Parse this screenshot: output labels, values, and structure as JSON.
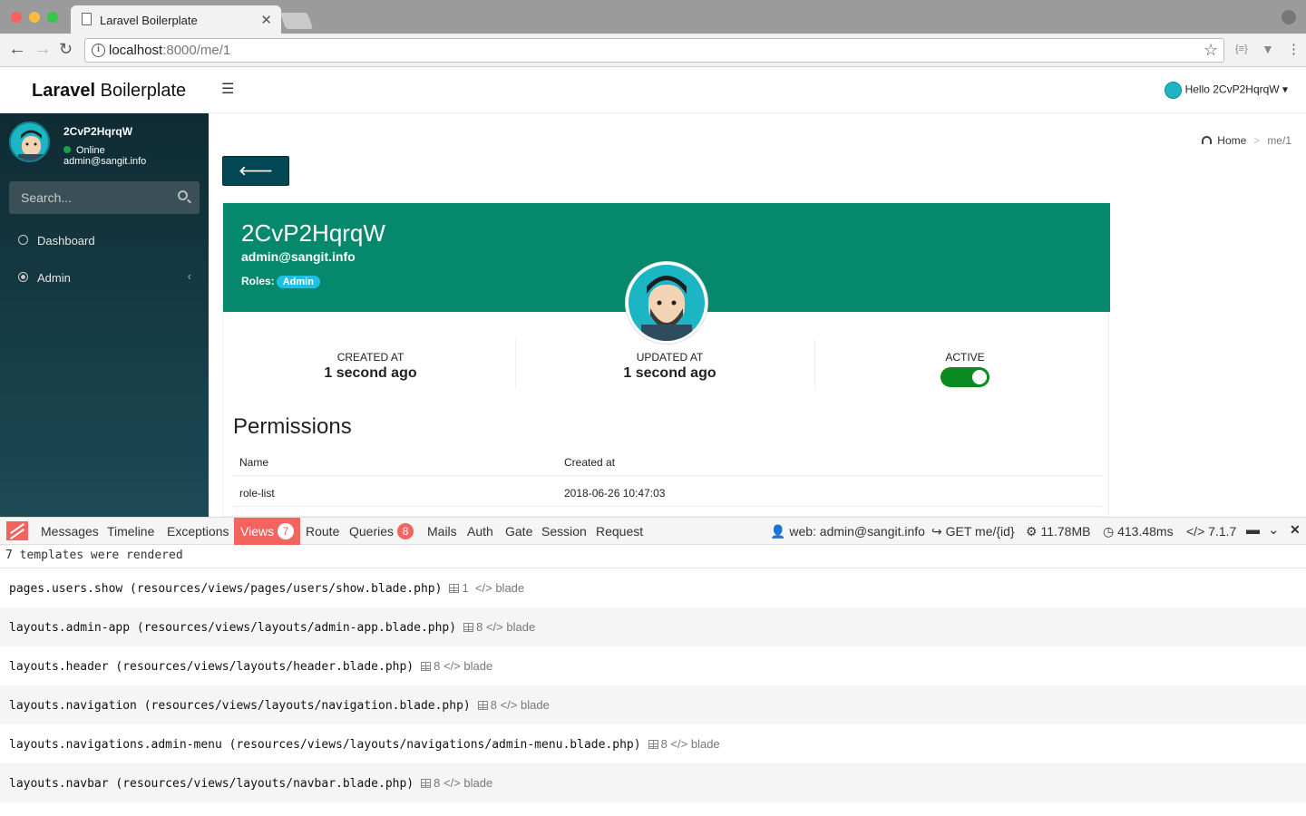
{
  "browser": {
    "tab_title": "Laravel Boilerplate",
    "url_host": "localhost",
    "url_rest": ":8000/me/1"
  },
  "header": {
    "logo_bold": "Laravel",
    "logo_light": "Boilerplate",
    "hello": "Hello 2CvP2HqrqW"
  },
  "sidebar": {
    "username": "2CvP2HqrqW",
    "status": "Online",
    "email": "admin@sangit.info",
    "search_placeholder": "Search...",
    "items": [
      {
        "label": "Dashboard",
        "icon": "dashboard-icon"
      },
      {
        "label": "Admin",
        "icon": "circle-dot-icon"
      }
    ]
  },
  "breadcrumb": {
    "home": "Home",
    "sep": ">",
    "current": "me/1"
  },
  "back_label": "Back",
  "profile": {
    "name": "2CvP2HqrqW",
    "email": "admin@sangit.info",
    "roles_label": "Roles:",
    "role": "Admin",
    "stats": [
      {
        "label": "CREATED AT",
        "value": "1 second ago"
      },
      {
        "label": "UPDATED AT",
        "value": "1 second ago"
      },
      {
        "label": "ACTIVE",
        "value": true
      }
    ]
  },
  "permissions": {
    "title": "Permissions",
    "columns": [
      "Name",
      "Created at"
    ],
    "rows": [
      [
        "role-list",
        "2018-06-26 10:47:03"
      ]
    ]
  },
  "debugbar": {
    "tabs": [
      "Messages",
      "Timeline",
      "Exceptions",
      "Views",
      "Route",
      "Queries",
      "Mails",
      "Auth",
      "Gate",
      "Session",
      "Request"
    ],
    "views_count": "7",
    "queries_count": "8",
    "indicators": {
      "user": "web: admin@sangit.info",
      "route": "GET me/{id}",
      "memory": "11.78MB",
      "time": "413.48ms",
      "version": "7.1.7"
    },
    "summary": "7 templates were rendered",
    "templates": [
      {
        "name": "pages.users.show (resources/views/pages/users/show.blade.php)",
        "params": "1",
        "type": "blade"
      },
      {
        "name": "layouts.admin-app (resources/views/layouts/admin-app.blade.php)",
        "params": "8",
        "type": "blade"
      },
      {
        "name": "layouts.header (resources/views/layouts/header.blade.php)",
        "params": "8",
        "type": "blade"
      },
      {
        "name": "layouts.navigation (resources/views/layouts/navigation.blade.php)",
        "params": "8",
        "type": "blade"
      },
      {
        "name": "layouts.navigations.admin-menu (resources/views/layouts/navigations/admin-menu.blade.php)",
        "params": "8",
        "type": "blade"
      },
      {
        "name": "layouts.navbar (resources/views/layouts/navbar.blade.php)",
        "params": "8",
        "type": "blade"
      }
    ]
  },
  "colors": {
    "brand_green": "#05886b",
    "sidebar_dark": "#0f2b33",
    "debug_red": "#f4645f",
    "back_button": "#034754"
  }
}
